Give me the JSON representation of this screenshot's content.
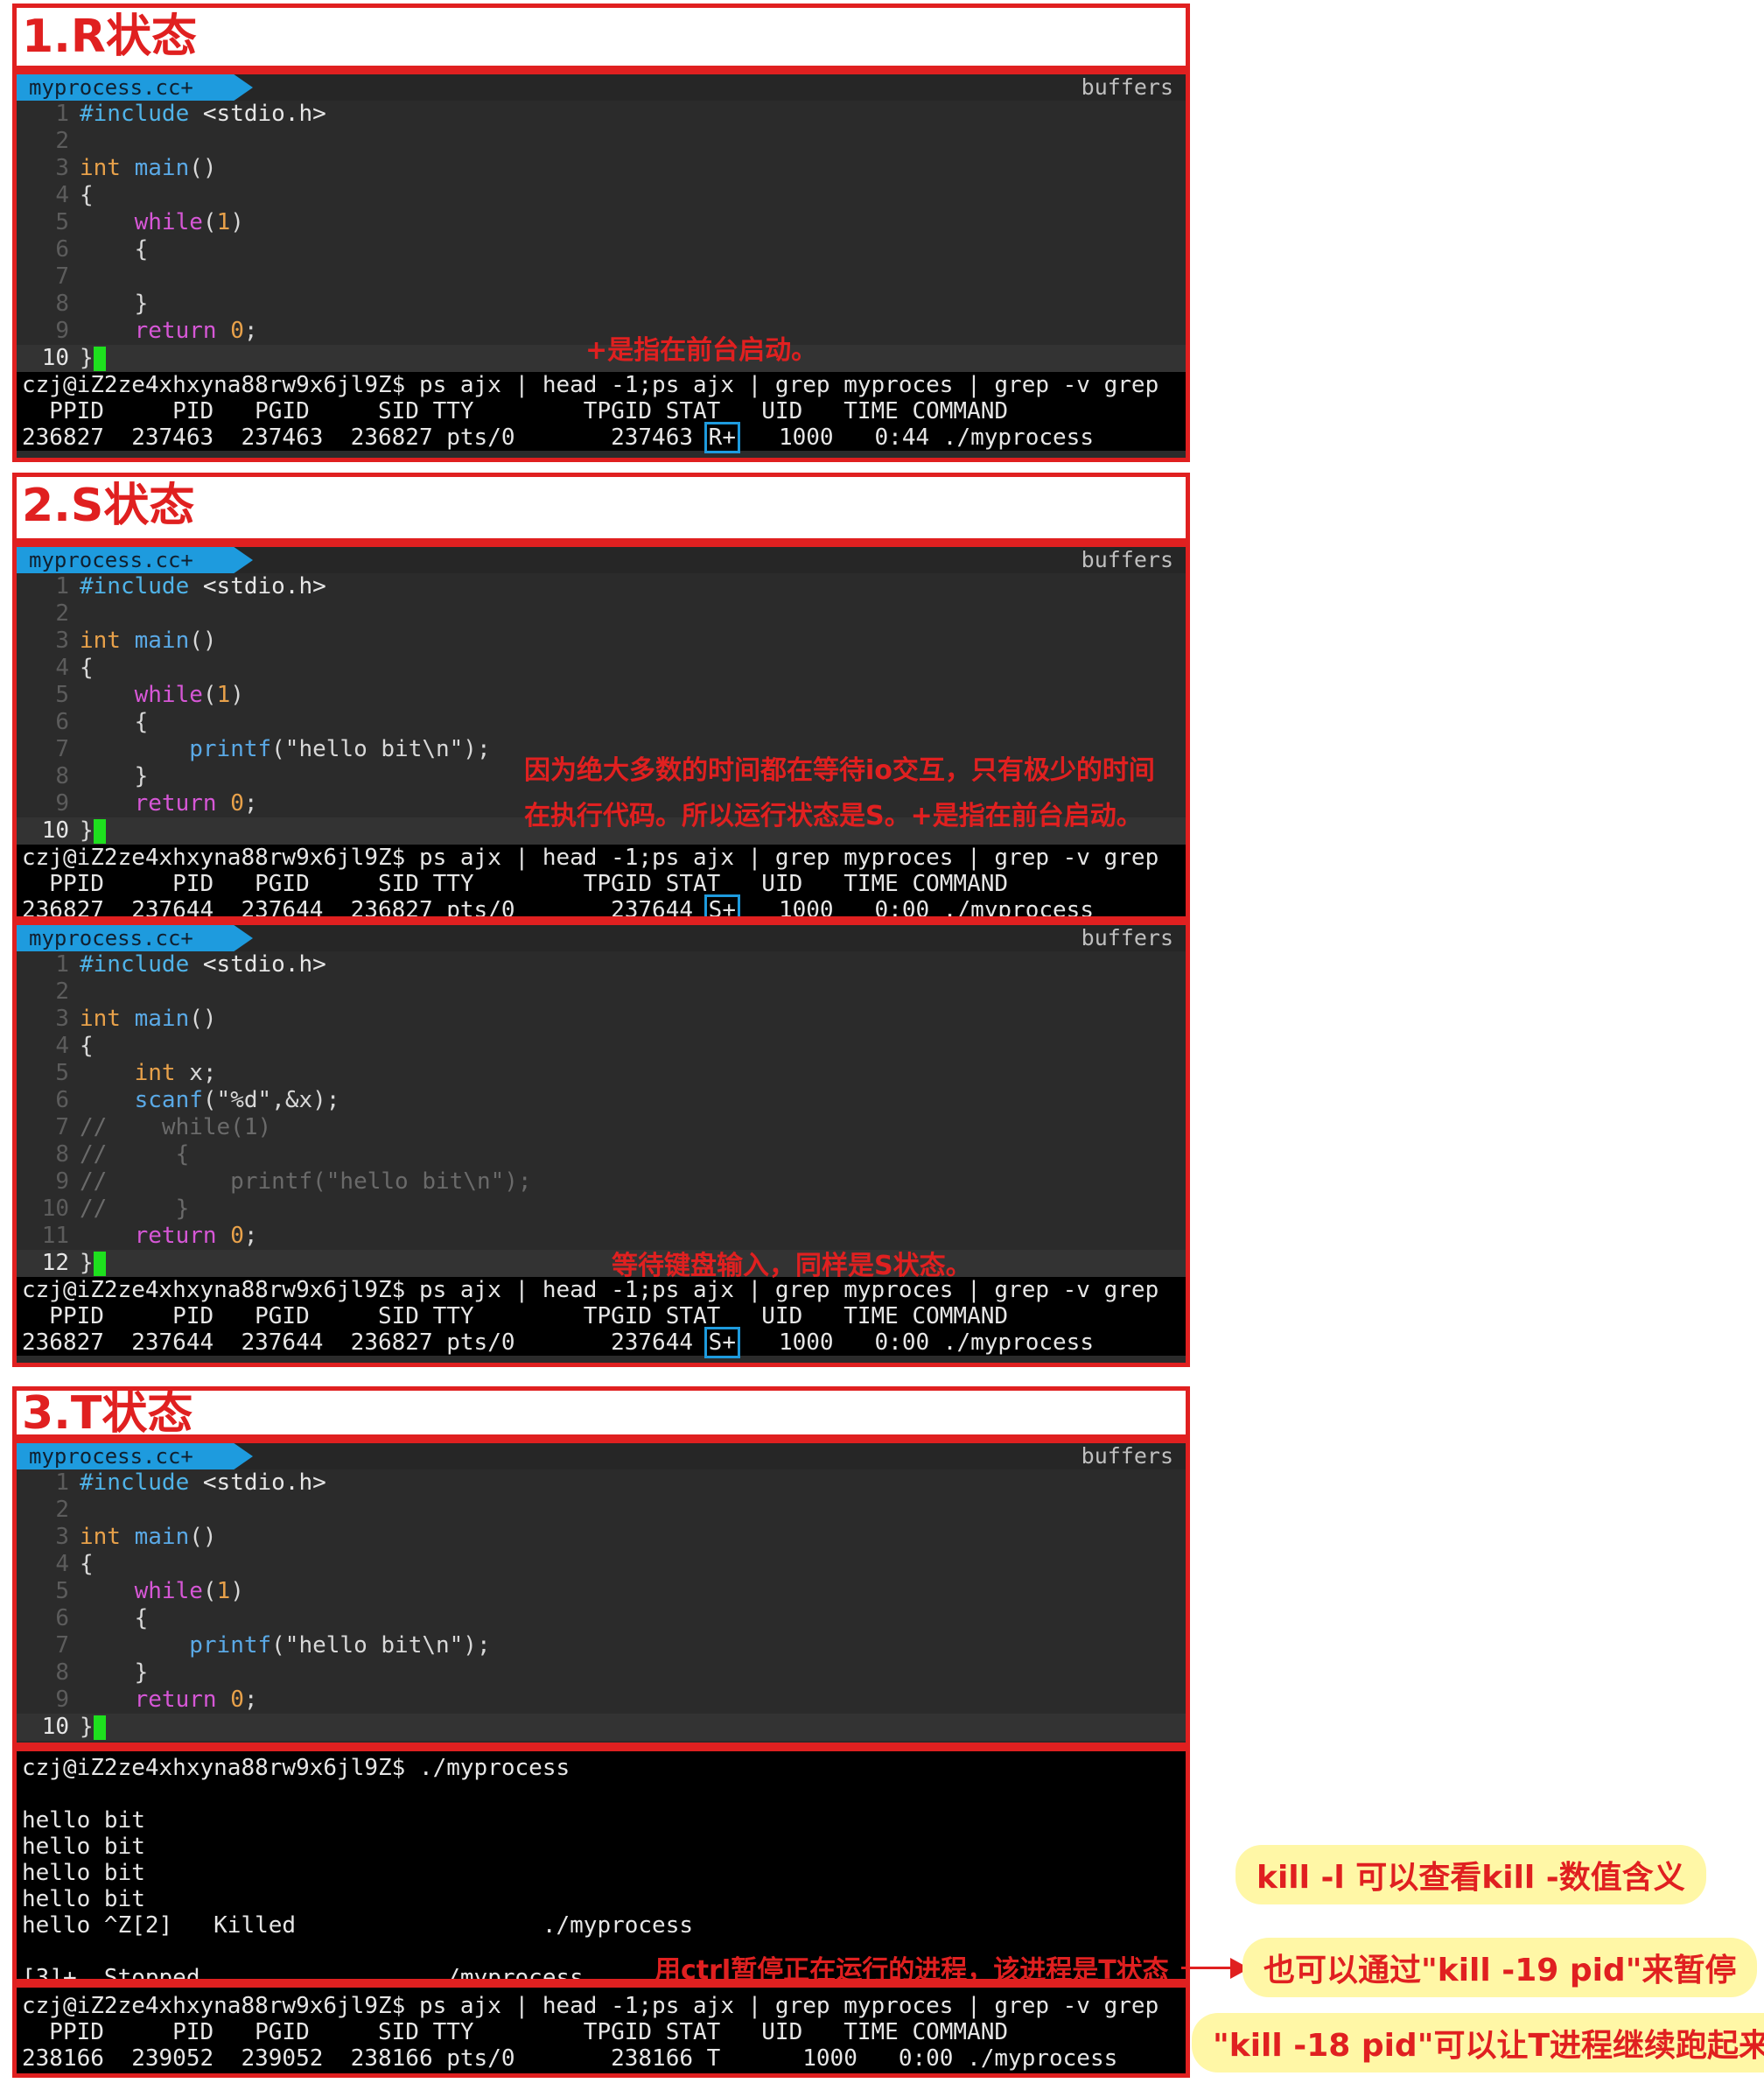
{
  "sections": {
    "r": {
      "title": "1.R状态",
      "tab": "myprocess.cc+",
      "buffers": "buffers",
      "code": [
        {
          "n": "1",
          "t": "#include <stdio.h>"
        },
        {
          "n": "2",
          "t": ""
        },
        {
          "n": "3",
          "t": "int main()"
        },
        {
          "n": "4",
          "t": "{"
        },
        {
          "n": "5",
          "t": "    while(1)"
        },
        {
          "n": "6",
          "t": "    {"
        },
        {
          "n": "7",
          "t": ""
        },
        {
          "n": "8",
          "t": "    }"
        },
        {
          "n": "9",
          "t": "    return 0;"
        },
        {
          "n": "10",
          "t": "}"
        }
      ],
      "note": "+是指在前台启动。",
      "terminal": {
        "cmd": "czj@iZ2ze4xhxyna88rw9x6jl9Z$ ps ajx | head -1;ps ajx | grep myproces | grep -v grep",
        "header": "  PPID     PID   PGID     SID TTY        TPGID STAT   UID   TIME COMMAND",
        "row_pre": "236827  237463  237463  236827 pts/0       237463 ",
        "stat": "R+",
        "row_post": "   1000   0:44 ./myprocess"
      }
    },
    "s": {
      "title": "2.S状态",
      "a": {
        "tab": "myprocess.cc+",
        "buffers": "buffers",
        "code": [
          {
            "n": "1",
            "t": "#include <stdio.h>"
          },
          {
            "n": "2",
            "t": ""
          },
          {
            "n": "3",
            "t": "int main()"
          },
          {
            "n": "4",
            "t": "{"
          },
          {
            "n": "5",
            "t": "    while(1)"
          },
          {
            "n": "6",
            "t": "    {"
          },
          {
            "n": "7",
            "t": "        printf(\"hello bit\\n\");"
          },
          {
            "n": "8",
            "t": "    }"
          },
          {
            "n": "9",
            "t": "    return 0;"
          },
          {
            "n": "10",
            "t": "}"
          }
        ],
        "note_line1": "因为绝大多数的时间都在等待io交互，只有极少的时间",
        "note_line2": "在执行代码。所以运行状态是S。+是指在前台启动。",
        "terminal": {
          "cmd": "czj@iZ2ze4xhxyna88rw9x6jl9Z$ ps ajx | head -1;ps ajx | grep myproces | grep -v grep",
          "header": "  PPID     PID   PGID     SID TTY        TPGID STAT   UID   TIME COMMAND",
          "row_pre": "236827  237644  237644  236827 pts/0       237644 ",
          "stat": "S+",
          "row_post": "   1000   0:00 ./myprocess"
        }
      },
      "b": {
        "tab": "myprocess.cc+",
        "buffers": "buffers",
        "code": [
          {
            "n": "1",
            "t": "#include <stdio.h>"
          },
          {
            "n": "2",
            "t": ""
          },
          {
            "n": "3",
            "t": "int main()"
          },
          {
            "n": "4",
            "t": "{"
          },
          {
            "n": "5",
            "t": "    int x;"
          },
          {
            "n": "6",
            "t": "    scanf(\"%d\",&x);"
          },
          {
            "n": "7",
            "t": "//    while(1)"
          },
          {
            "n": "8",
            "t": "//     {"
          },
          {
            "n": "9",
            "t": "//         printf(\"hello bit\\n\");"
          },
          {
            "n": "10",
            "t": "//     }"
          },
          {
            "n": "11",
            "t": "    return 0;"
          },
          {
            "n": "12",
            "t": "}"
          }
        ],
        "note": "等待键盘输入，同样是S状态。",
        "terminal": {
          "cmd": "czj@iZ2ze4xhxyna88rw9x6jl9Z$ ps ajx | head -1;ps ajx | grep myproces | grep -v grep",
          "header": "  PPID     PID   PGID     SID TTY        TPGID STAT   UID   TIME COMMAND",
          "row_pre": "236827  237644  237644  236827 pts/0       237644 ",
          "stat": "S+",
          "row_post": "   1000   0:00 ./myprocess"
        }
      }
    },
    "t": {
      "title": "3.T状态",
      "tab": "myprocess.cc+",
      "buffers": "buffers",
      "code": [
        {
          "n": "1",
          "t": "#include <stdio.h>"
        },
        {
          "n": "2",
          "t": ""
        },
        {
          "n": "3",
          "t": "int main()"
        },
        {
          "n": "4",
          "t": "{"
        },
        {
          "n": "5",
          "t": "    while(1)"
        },
        {
          "n": "6",
          "t": "    {"
        },
        {
          "n": "7",
          "t": "        printf(\"hello bit\\n\");"
        },
        {
          "n": "8",
          "t": "    }"
        },
        {
          "n": "9",
          "t": "    return 0;"
        },
        {
          "n": "10",
          "t": "}"
        }
      ],
      "run": [
        "czj@iZ2ze4xhxyna88rw9x6jl9Z$ ./myprocess",
        "",
        "hello bit",
        "hello bit",
        "hello bit",
        "hello bit",
        "hello ^Z[2]   Killed                  ./myprocess",
        "",
        "[3]+  Stopped                 ./myprocess"
      ],
      "stop_note": "用ctrl暂停正在运行的进程，该进程是T状态",
      "terminal": {
        "cmd": "czj@iZ2ze4xhxyna88rw9x6jl9Z$ ps ajx | head -1;ps ajx | grep myproces | grep -v grep",
        "header": "  PPID     PID   PGID     SID TTY        TPGID STAT   UID   TIME COMMAND",
        "row": "238166  239052  239052  238166 pts/0       238166 T      1000   0:00 ./myprocess"
      },
      "side_notes": {
        "kill_l": "kill -l 可以查看kill -数值含义",
        "kill_19": "也可以通过\"kill -19 pid\"来暂停",
        "kill_18": "\"kill -18 pid\"可以让T进程继续跑起来"
      }
    }
  }
}
